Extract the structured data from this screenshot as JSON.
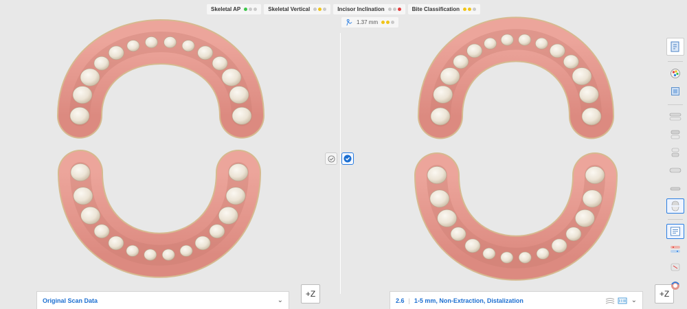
{
  "indicators": [
    {
      "label": "Skeletal AP",
      "dots": [
        "#3cc44a",
        "#c9c9c9",
        "#c9c9c9"
      ]
    },
    {
      "label": "Skeletal Vertical",
      "dots": [
        "#c9c9c9",
        "#f0c419",
        "#c9c9c9"
      ]
    },
    {
      "label": "Incisor Inclination",
      "dots": [
        "#c9c9c9",
        "#c9c9c9",
        "#e23b3b"
      ]
    },
    {
      "label": "Bite Classification",
      "dots": [
        "#f0c419",
        "#f0c419",
        "#c9c9c9"
      ]
    }
  ],
  "measurement": {
    "value": "1.37 mm",
    "dots": [
      "#f0c419",
      "#f0c419",
      "#c9c9c9"
    ]
  },
  "left_panel": {
    "title": "Original Scan Data"
  },
  "right_panel": {
    "number": "2.6",
    "title": "1-5 mm, Non-Extraction, Distalization"
  },
  "z_button_label": "+Z",
  "colors": {
    "accent": "#1c6fd1",
    "gum": "#e4958c",
    "tooth": "#efe8dc"
  },
  "toolbar_icons": [
    "document-icon",
    "color-map-icon",
    "cube-view-icon",
    "upper-arch-icon",
    "overlay-icon",
    "split-icon",
    "lower-arch-icon",
    "bite-icon",
    "occlusal-view-icon",
    "report-icon",
    "attachment-icon",
    "ipr-icon",
    "aligner-icon"
  ]
}
